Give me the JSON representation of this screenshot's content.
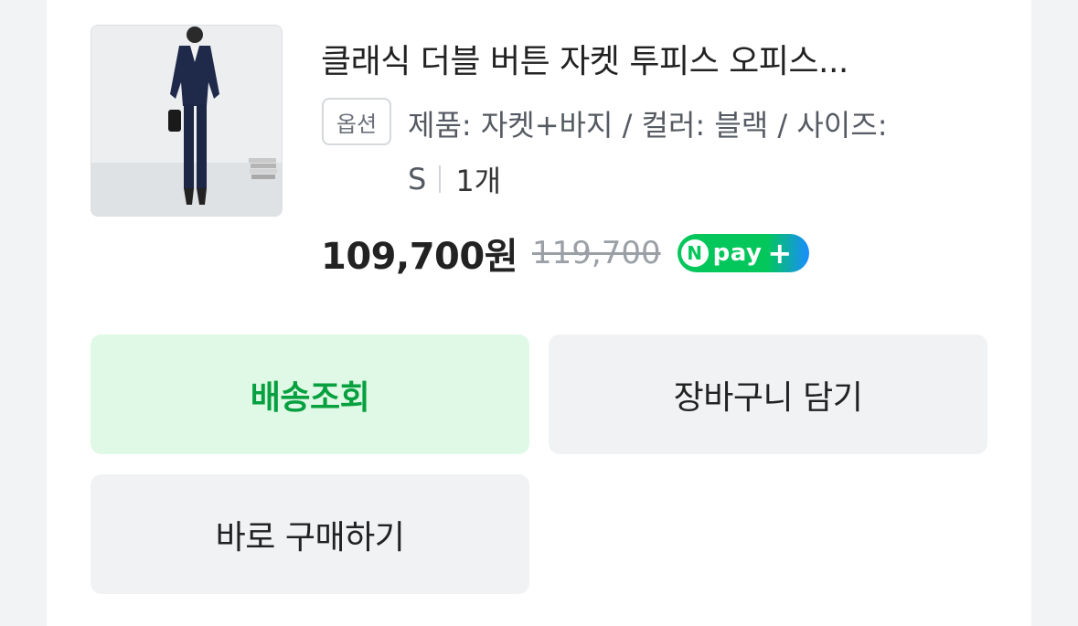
{
  "product": {
    "title": "클래식 더블 버튼 자켓 투피스 오피스...",
    "option_badge": "옵션",
    "option_text": "제품: 자켓+바지 / 컬러: 블랙 / 사이즈:",
    "option_size": "S",
    "quantity": "1개",
    "price": "109,700원",
    "original_price": "119,700",
    "npay_label": "pay"
  },
  "actions": {
    "track_label": "배송조회",
    "cart_label": "장바구니 담기",
    "buy_label": "바로 구매하기"
  },
  "colors": {
    "accent_green": "#03c75a",
    "track_text": "#07a03f",
    "track_bg": "#dff9e6"
  }
}
